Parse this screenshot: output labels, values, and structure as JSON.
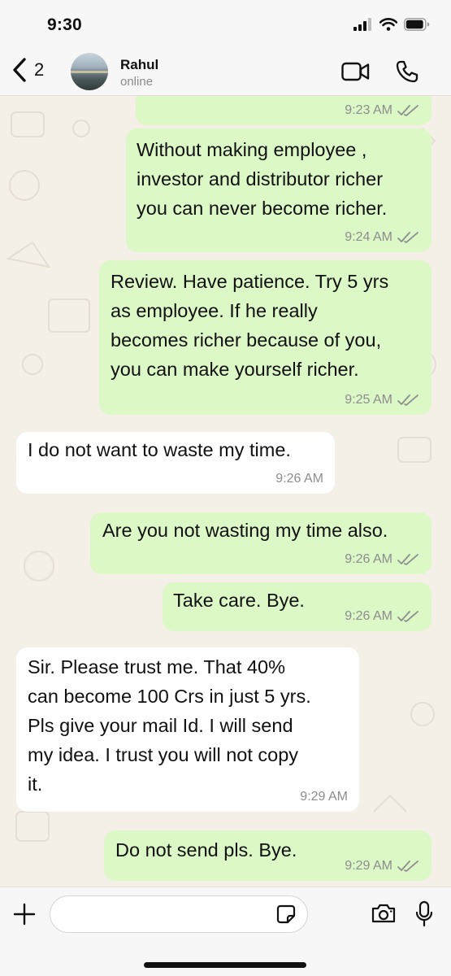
{
  "status_bar": {
    "time": "9:30",
    "battery_level": 0.95
  },
  "header": {
    "back_count": "2",
    "contact_name": "Rahul",
    "contact_status": "online"
  },
  "messages": [
    {
      "direction": "outgoing",
      "lines": [],
      "time": "9:23 AM",
      "read": true
    },
    {
      "direction": "outgoing",
      "lines": [
        "Without making employee ,",
        "investor and distributor richer",
        "you can never become richer."
      ],
      "time": "9:24 AM",
      "read": true
    },
    {
      "direction": "outgoing",
      "lines": [
        "Review. Have patience. Try 5 yrs",
        "as employee. If he really",
        "becomes richer because of you,",
        "you can make yourself richer."
      ],
      "time": "9:25 AM",
      "read": true
    },
    {
      "direction": "incoming",
      "lines": [
        "I do not want to waste my time."
      ],
      "time": "9:26 AM"
    },
    {
      "direction": "outgoing",
      "lines": [
        "Are you not wasting my time also."
      ],
      "time": "9:26 AM",
      "read": true
    },
    {
      "direction": "outgoing",
      "lines": [
        "Take care. Bye."
      ],
      "time": "9:26 AM",
      "read": true
    },
    {
      "direction": "incoming",
      "lines": [
        "Sir. Please trust me. That 40%",
        "can become 100 Crs in just 5 yrs.",
        "Pls give your mail Id. I will send",
        "my idea. I trust you will not copy",
        "it."
      ],
      "time": "9:29 AM"
    },
    {
      "direction": "outgoing",
      "lines": [
        "Do not send pls. Bye."
      ],
      "time": "9:29 AM",
      "read": true
    }
  ],
  "input": {
    "value": "",
    "placeholder": ""
  },
  "icons": {
    "back": "chevron-left-icon",
    "video": "video-camera-icon",
    "call": "phone-icon",
    "plus": "plus-icon",
    "sticker": "sticker-icon",
    "camera": "camera-icon",
    "mic": "microphone-icon",
    "read_receipt": "double-check-icon"
  },
  "colors": {
    "outgoing_bubble": "#dcf8c6",
    "incoming_bubble": "#ffffff",
    "chat_background": "#f4efe7",
    "read_tick": "#8d8d8d"
  }
}
